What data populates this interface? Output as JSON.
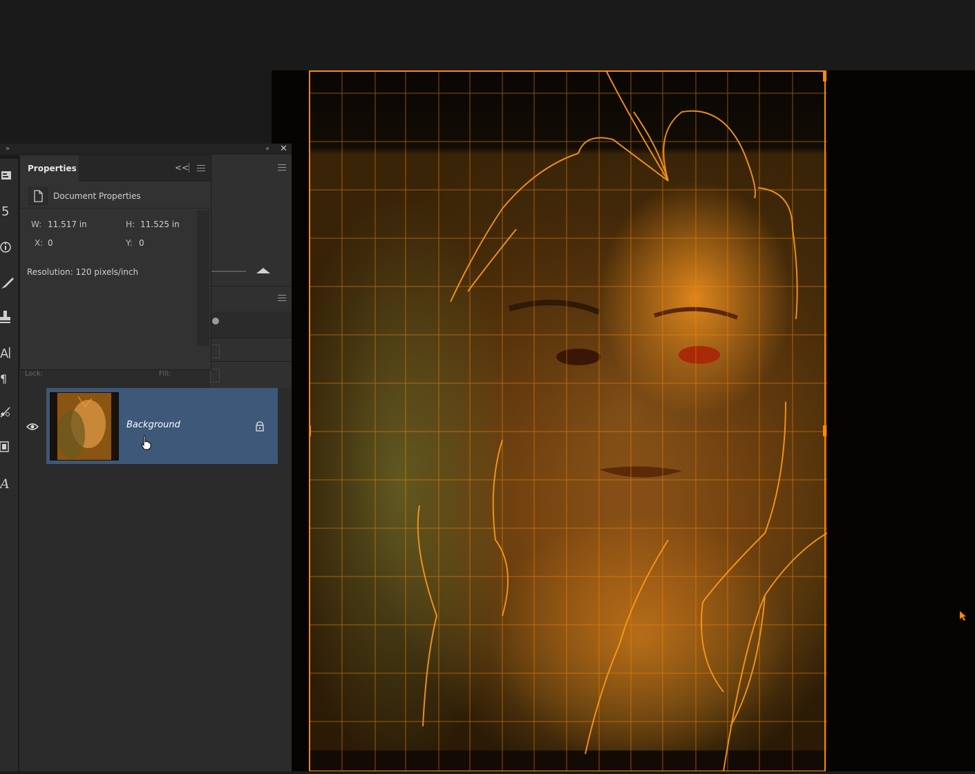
{
  "properties_panel": {
    "tab_label": "Properties",
    "section_title": "Document Properties",
    "width_label": "W:",
    "width_value": "11.517 in",
    "height_label": "H:",
    "height_value": "11.525 in",
    "x_label": "X:",
    "x_value": "0",
    "y_label": "Y:",
    "y_value": "0",
    "resolution": "Resolution: 120 pixels/inch"
  },
  "layers_panel": {
    "layer_name": "Background",
    "lock_label": "Lock:",
    "fill_label": "Fill:"
  },
  "colors": {
    "accent_orange": "#ff8a00",
    "selection_blue": "#3d5878",
    "panel_bg": "#323232",
    "app_bg": "#1a1a1a"
  },
  "icons": [
    "document-icon",
    "collapse-icon",
    "panel-menu-icon",
    "close-icon",
    "eye-icon",
    "lock-icon",
    "brush-icon",
    "stamp-icon",
    "text-icon",
    "paragraph-icon",
    "info-icon",
    "history-icon",
    "pointer-hand-icon"
  ]
}
